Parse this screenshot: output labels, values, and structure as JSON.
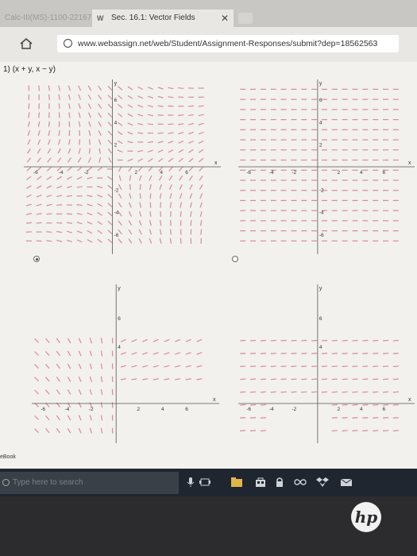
{
  "browser": {
    "inactive_tab": "Calc-III(MS)-1100-22167",
    "active_tab": {
      "title": "Sec. 16.1: Vector Fields",
      "logo": "W",
      "close": "✕"
    },
    "url": "www.webassign.net/web/Student/Assignment-Responses/submit?dep=18562563"
  },
  "question": {
    "label": "(x + y, x − y)"
  },
  "plots": [
    {
      "id": "a",
      "selected": true,
      "ticks": [
        "-6",
        "-4",
        "-2",
        "2",
        "4",
        "6"
      ],
      "yticks": [
        "6",
        "4",
        "2",
        "-2",
        "-4",
        "-6"
      ],
      "axis_x": "x",
      "axis_y": "y",
      "color": "#d98a98"
    },
    {
      "id": "b",
      "selected": false,
      "ticks": [
        "-6",
        "-4",
        "-2",
        "2",
        "4",
        "6"
      ],
      "yticks": [
        "6",
        "4",
        "2",
        "-2",
        "-4",
        "-6"
      ],
      "axis_x": "x",
      "axis_y": "y",
      "color": "#d98a98"
    },
    {
      "id": "c",
      "selected": false,
      "ticks": [
        "-6",
        "-4",
        "-2",
        "2",
        "4",
        "6"
      ],
      "yticks": [
        "6",
        "4"
      ],
      "axis_x": "x",
      "axis_y": "y",
      "color": "#d98a98"
    },
    {
      "id": "d",
      "selected": false,
      "ticks": [
        "-6",
        "-4",
        "-2",
        "2",
        "4",
        "6"
      ],
      "yticks": [
        "6",
        "4"
      ],
      "axis_x": "x",
      "axis_y": "y",
      "color": "#d98a98"
    }
  ],
  "side_label": "eBook",
  "taskbar": {
    "search_placeholder": "Type here to search"
  },
  "brand": "hp"
}
